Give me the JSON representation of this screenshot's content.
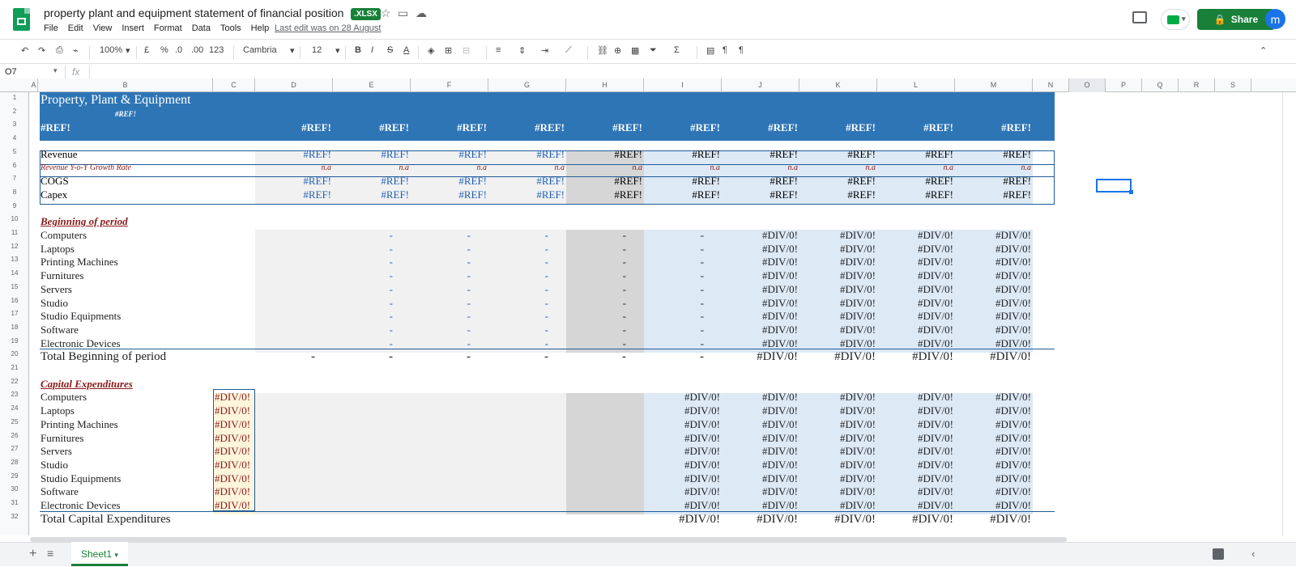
{
  "doc": {
    "title": "property plant and equipment statement of financial position",
    "badge": ".XLSX",
    "last_edit": "Last edit was on 28 August"
  },
  "menu": [
    "File",
    "Edit",
    "View",
    "Insert",
    "Format",
    "Data",
    "Tools",
    "Help"
  ],
  "header": {
    "share": "Share",
    "avatar": "m"
  },
  "toolbar": {
    "zoom": "100%",
    "currency": "£",
    "percent": "%",
    "dec_less": ".0",
    "dec_more": ".00",
    "more_formats": "123",
    "font": "Cambria",
    "font_size": "12",
    "bold": "B",
    "italic": "I",
    "strike": "S",
    "text_color": "A"
  },
  "formula": {
    "cell_ref": "O7",
    "fx": "fx",
    "value": ""
  },
  "columns": [
    "A",
    "B",
    "C",
    "D",
    "E",
    "F",
    "G",
    "H",
    "I",
    "J",
    "K",
    "L",
    "M",
    "N",
    "O",
    "P",
    "Q",
    "R",
    "S"
  ],
  "rows": [
    "1",
    "2",
    "3",
    "4",
    "5",
    "6",
    "7",
    "8",
    "9",
    "10",
    "11",
    "12",
    "13",
    "14",
    "15",
    "16",
    "17",
    "18",
    "19",
    "20",
    "21",
    "22",
    "23",
    "24",
    "25",
    "26",
    "27",
    "28",
    "29",
    "30",
    "31",
    "32"
  ],
  "sheet": {
    "heading": "Property, Plant & Equipment",
    "sub_ref": "#REF!",
    "header_row": [
      "#REF!",
      "#REF!",
      "#REF!",
      "#REF!",
      "#REF!",
      "#REF!",
      "#REF!",
      "#REF!",
      "#REF!",
      "#REF!",
      "#REF!"
    ],
    "revenue": {
      "label": "Revenue",
      "values": [
        "#REF!",
        "#REF!",
        "#REF!",
        "#REF!",
        "#REF!",
        "#REF!",
        "#REF!",
        "#REF!",
        "#REF!",
        "#REF!"
      ]
    },
    "growth": {
      "label": "Revenue Y-o-Y Growth Rate",
      "values": [
        "n.a",
        "n.a",
        "n.a",
        "n.a",
        "n.a",
        "n.a",
        "n.a",
        "n.a",
        "n.a",
        "n.a"
      ]
    },
    "cogs": {
      "label": "COGS",
      "values": [
        "#REF!",
        "#REF!",
        "#REF!",
        "#REF!",
        "#REF!",
        "#REF!",
        "#REF!",
        "#REF!",
        "#REF!",
        "#REF!"
      ]
    },
    "capex": {
      "label": "Capex",
      "values": [
        "#REF!",
        "#REF!",
        "#REF!",
        "#REF!",
        "#REF!",
        "#REF!",
        "#REF!",
        "#REF!",
        "#REF!",
        "#REF!"
      ]
    },
    "beginning": {
      "title": "Beginning of period",
      "items": [
        "Computers",
        "Laptops",
        "Printing Machines",
        "Furnitures",
        "Servers",
        "Studio",
        "Studio Equipments",
        "Software",
        "Electronic Devices"
      ],
      "values": [
        "-",
        "-",
        "-",
        "-",
        "-",
        "#DIV/0!",
        "#DIV/0!",
        "#DIV/0!",
        "#DIV/0!"
      ],
      "total_label": "Total Beginning of period",
      "total_values": [
        "-",
        "-",
        "-",
        "-",
        "-",
        "-",
        "#DIV/0!",
        "#DIV/0!",
        "#DIV/0!",
        "#DIV/0!"
      ]
    },
    "capital": {
      "title": "Capital Expenditures",
      "items": [
        "Computers",
        "Laptops",
        "Printing Machines",
        "Furnitures",
        "Servers",
        "Studio",
        "Studio Equipments",
        "Software",
        "Electronic Devices"
      ],
      "c_value": "#DIV/0!",
      "values": [
        "#DIV/0!",
        "#DIV/0!",
        "#DIV/0!",
        "#DIV/0!",
        "#DIV/0!"
      ],
      "total_label": "Total Capital Expenditures",
      "total_values": [
        "#DIV/0!",
        "#DIV/0!",
        "#DIV/0!",
        "#DIV/0!",
        "#DIV/0!"
      ]
    }
  },
  "tabs": {
    "sheet1": "Sheet1"
  },
  "colors": {
    "brand_green": "#188038",
    "header_blue": "#2e75b6",
    "link_blue": "#1f5fb4",
    "dark_red": "#8b1a1a"
  }
}
